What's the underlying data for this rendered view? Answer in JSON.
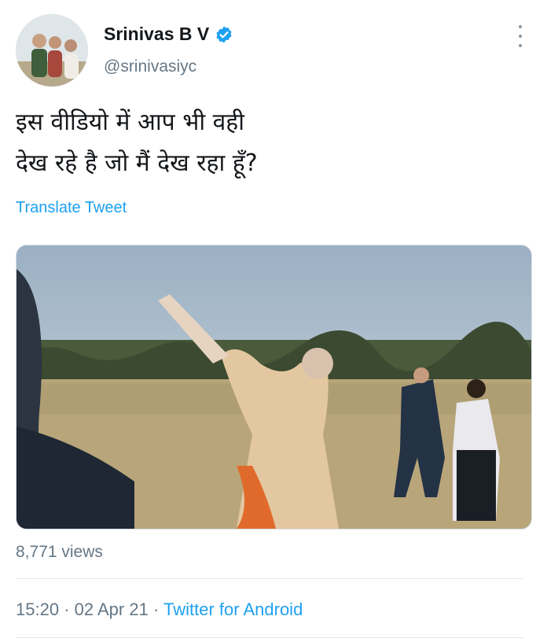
{
  "header": {
    "display_name": "Srinivas B V",
    "handle": "@srinivasiyc",
    "verified_icon": "verified-badge-icon",
    "more_icon": "more-vertical-icon",
    "accent_color": "#1da1f2"
  },
  "tweet": {
    "text_lines": [
      "इस वीडियो में आप भी वही",
      "देख रहे है जो मैं देख रहा हूँ?"
    ],
    "translate_label": "Translate Tweet"
  },
  "media": {
    "type": "video"
  },
  "stats": {
    "views": "8,771 views"
  },
  "meta": {
    "time": "15:20",
    "separator": "·",
    "date": "02 Apr 21",
    "source": "Twitter for Android"
  }
}
